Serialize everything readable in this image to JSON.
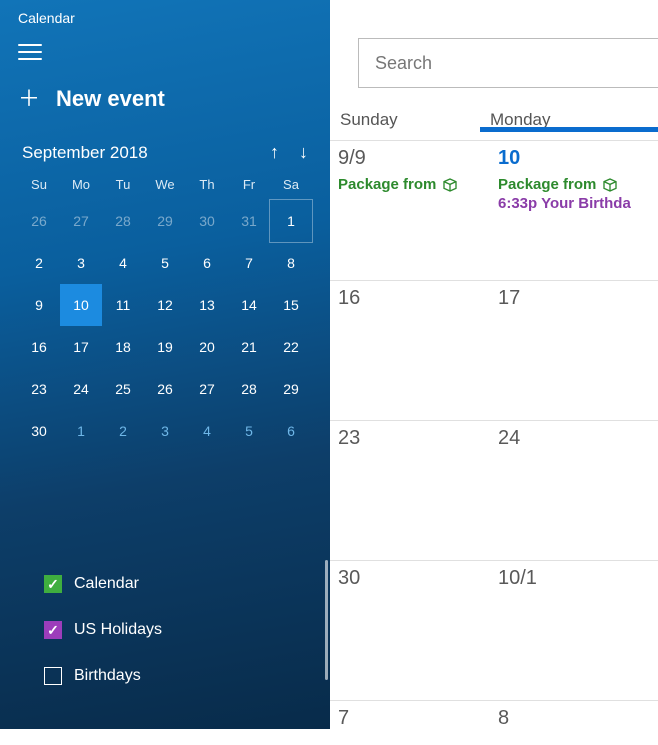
{
  "app_title": "Calendar",
  "new_event_label": "New event",
  "month_label": "September 2018",
  "dow": [
    "Su",
    "Mo",
    "Tu",
    "We",
    "Th",
    "Fr",
    "Sa"
  ],
  "mini": [
    {
      "n": "26",
      "cls": "other"
    },
    {
      "n": "27",
      "cls": "other"
    },
    {
      "n": "28",
      "cls": "other"
    },
    {
      "n": "29",
      "cls": "other"
    },
    {
      "n": "30",
      "cls": "other"
    },
    {
      "n": "31",
      "cls": "other"
    },
    {
      "n": "1",
      "cls": "first-box"
    },
    {
      "n": "2"
    },
    {
      "n": "3"
    },
    {
      "n": "4"
    },
    {
      "n": "5"
    },
    {
      "n": "6"
    },
    {
      "n": "7"
    },
    {
      "n": "8"
    },
    {
      "n": "9"
    },
    {
      "n": "10",
      "cls": "selected"
    },
    {
      "n": "11"
    },
    {
      "n": "12"
    },
    {
      "n": "13"
    },
    {
      "n": "14"
    },
    {
      "n": "15"
    },
    {
      "n": "16"
    },
    {
      "n": "17"
    },
    {
      "n": "18"
    },
    {
      "n": "19"
    },
    {
      "n": "20"
    },
    {
      "n": "21"
    },
    {
      "n": "22"
    },
    {
      "n": "23"
    },
    {
      "n": "24"
    },
    {
      "n": "25"
    },
    {
      "n": "26"
    },
    {
      "n": "27"
    },
    {
      "n": "28"
    },
    {
      "n": "29"
    },
    {
      "n": "30"
    },
    {
      "n": "1",
      "cls": "next-other"
    },
    {
      "n": "2",
      "cls": "next-other"
    },
    {
      "n": "3",
      "cls": "next-other"
    },
    {
      "n": "4",
      "cls": "next-other"
    },
    {
      "n": "5",
      "cls": "next-other"
    },
    {
      "n": "6",
      "cls": "next-other"
    }
  ],
  "calendars_list": {
    "cal": "Calendar",
    "hol": "US Holidays",
    "bday": "Birthdays"
  },
  "search_placeholder": "Search",
  "header_days": {
    "sun": "Sunday",
    "mon": "Monday"
  },
  "weeks": {
    "w1": {
      "sun": {
        "date": "9/9",
        "ev1": "Package from "
      },
      "mon": {
        "date": "10",
        "today": true,
        "ev1": "Package from ",
        "ev2": "6:33p Your Birthda"
      }
    },
    "w2": {
      "sun": {
        "date": "16"
      },
      "mon": {
        "date": "17"
      }
    },
    "w3": {
      "sun": {
        "date": "23"
      },
      "mon": {
        "date": "24"
      }
    },
    "w4": {
      "sun": {
        "date": "30"
      },
      "mon": {
        "date": "10/1"
      }
    },
    "w5": {
      "sun": {
        "date": "7"
      },
      "mon": {
        "date": "8"
      }
    }
  }
}
